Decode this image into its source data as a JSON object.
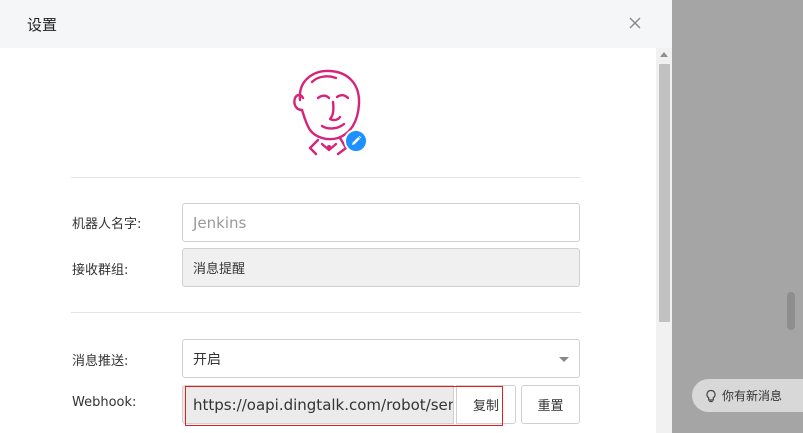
{
  "dialog": {
    "title": "设置",
    "close_icon": "close-icon",
    "avatar_icon": "jenkins-avatar",
    "edit_icon": "pencil-icon"
  },
  "form": {
    "robot_name": {
      "label": "机器人名字:",
      "placeholder": "Jenkins"
    },
    "group": {
      "label": "接收群组:",
      "value": "消息提醒"
    },
    "push": {
      "label": "消息推送:",
      "value": "开启"
    },
    "webhook": {
      "label": "Webhook:",
      "value": "https://oapi.dingtalk.com/robot/send",
      "copy_label": "复制",
      "reset_label": "重置"
    }
  },
  "toast": {
    "text": "你有新消息",
    "icon": "lightbulb-icon"
  },
  "colors": {
    "accent": "#1e90ff",
    "avatar": "#d6247a",
    "highlight": "#e02020"
  }
}
